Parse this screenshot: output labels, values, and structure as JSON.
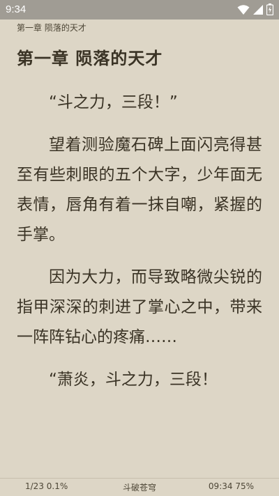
{
  "status_bar": {
    "time": "9:34"
  },
  "header": {
    "chapter": "第一章 陨落的天才"
  },
  "chapter_title": "第一章 陨落的天才",
  "paragraphs": [
    "“斗之力，三段！”",
    "望着测验魔石碑上面闪亮得甚至有些刺眼的五个大字，少年面无表情，唇角有着一抹自嘲，紧握的手掌。",
    "因为大力，而导致略微尖锐的指甲深深的刺进了掌心之中，带来一阵阵钻心的疼痛……",
    "“萧炎，斗之力，三段！"
  ],
  "footer": {
    "progress": "1/23  0.1%",
    "book_title": "斗破苍穹",
    "clock_battery": "09:34 75%"
  },
  "icons": [
    "wifi-icon",
    "signal-icon",
    "battery-icon"
  ]
}
